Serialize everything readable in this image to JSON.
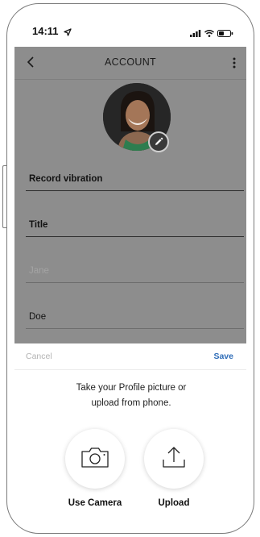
{
  "status_bar": {
    "time": "14:11",
    "icons": [
      "location-arrow-icon",
      "cellular-signal-icon",
      "wifi-icon",
      "battery-icon"
    ]
  },
  "nav": {
    "title": "ACCOUNT",
    "back_icon": "chevron-left-icon",
    "more_icon": "more-vertical-icon"
  },
  "profile": {
    "edit_icon": "pencil-icon"
  },
  "fields": [
    {
      "value": "Record vibration",
      "style": "bold"
    },
    {
      "value": "Title",
      "style": "bold"
    },
    {
      "placeholder": "Jane",
      "style": "placeholder"
    },
    {
      "value": "Doe",
      "style": "normal"
    }
  ],
  "sheet": {
    "cancel_label": "Cancel",
    "save_label": "Save",
    "message": "Take your Profile picture or upload from phone.",
    "options": [
      {
        "label": "Use Camera",
        "icon": "camera-icon"
      },
      {
        "label": "Upload",
        "icon": "upload-icon"
      }
    ]
  },
  "colors": {
    "overlay": "#8d8d8d",
    "save": "#2f6db8",
    "cancel": "#b3b3b3"
  }
}
